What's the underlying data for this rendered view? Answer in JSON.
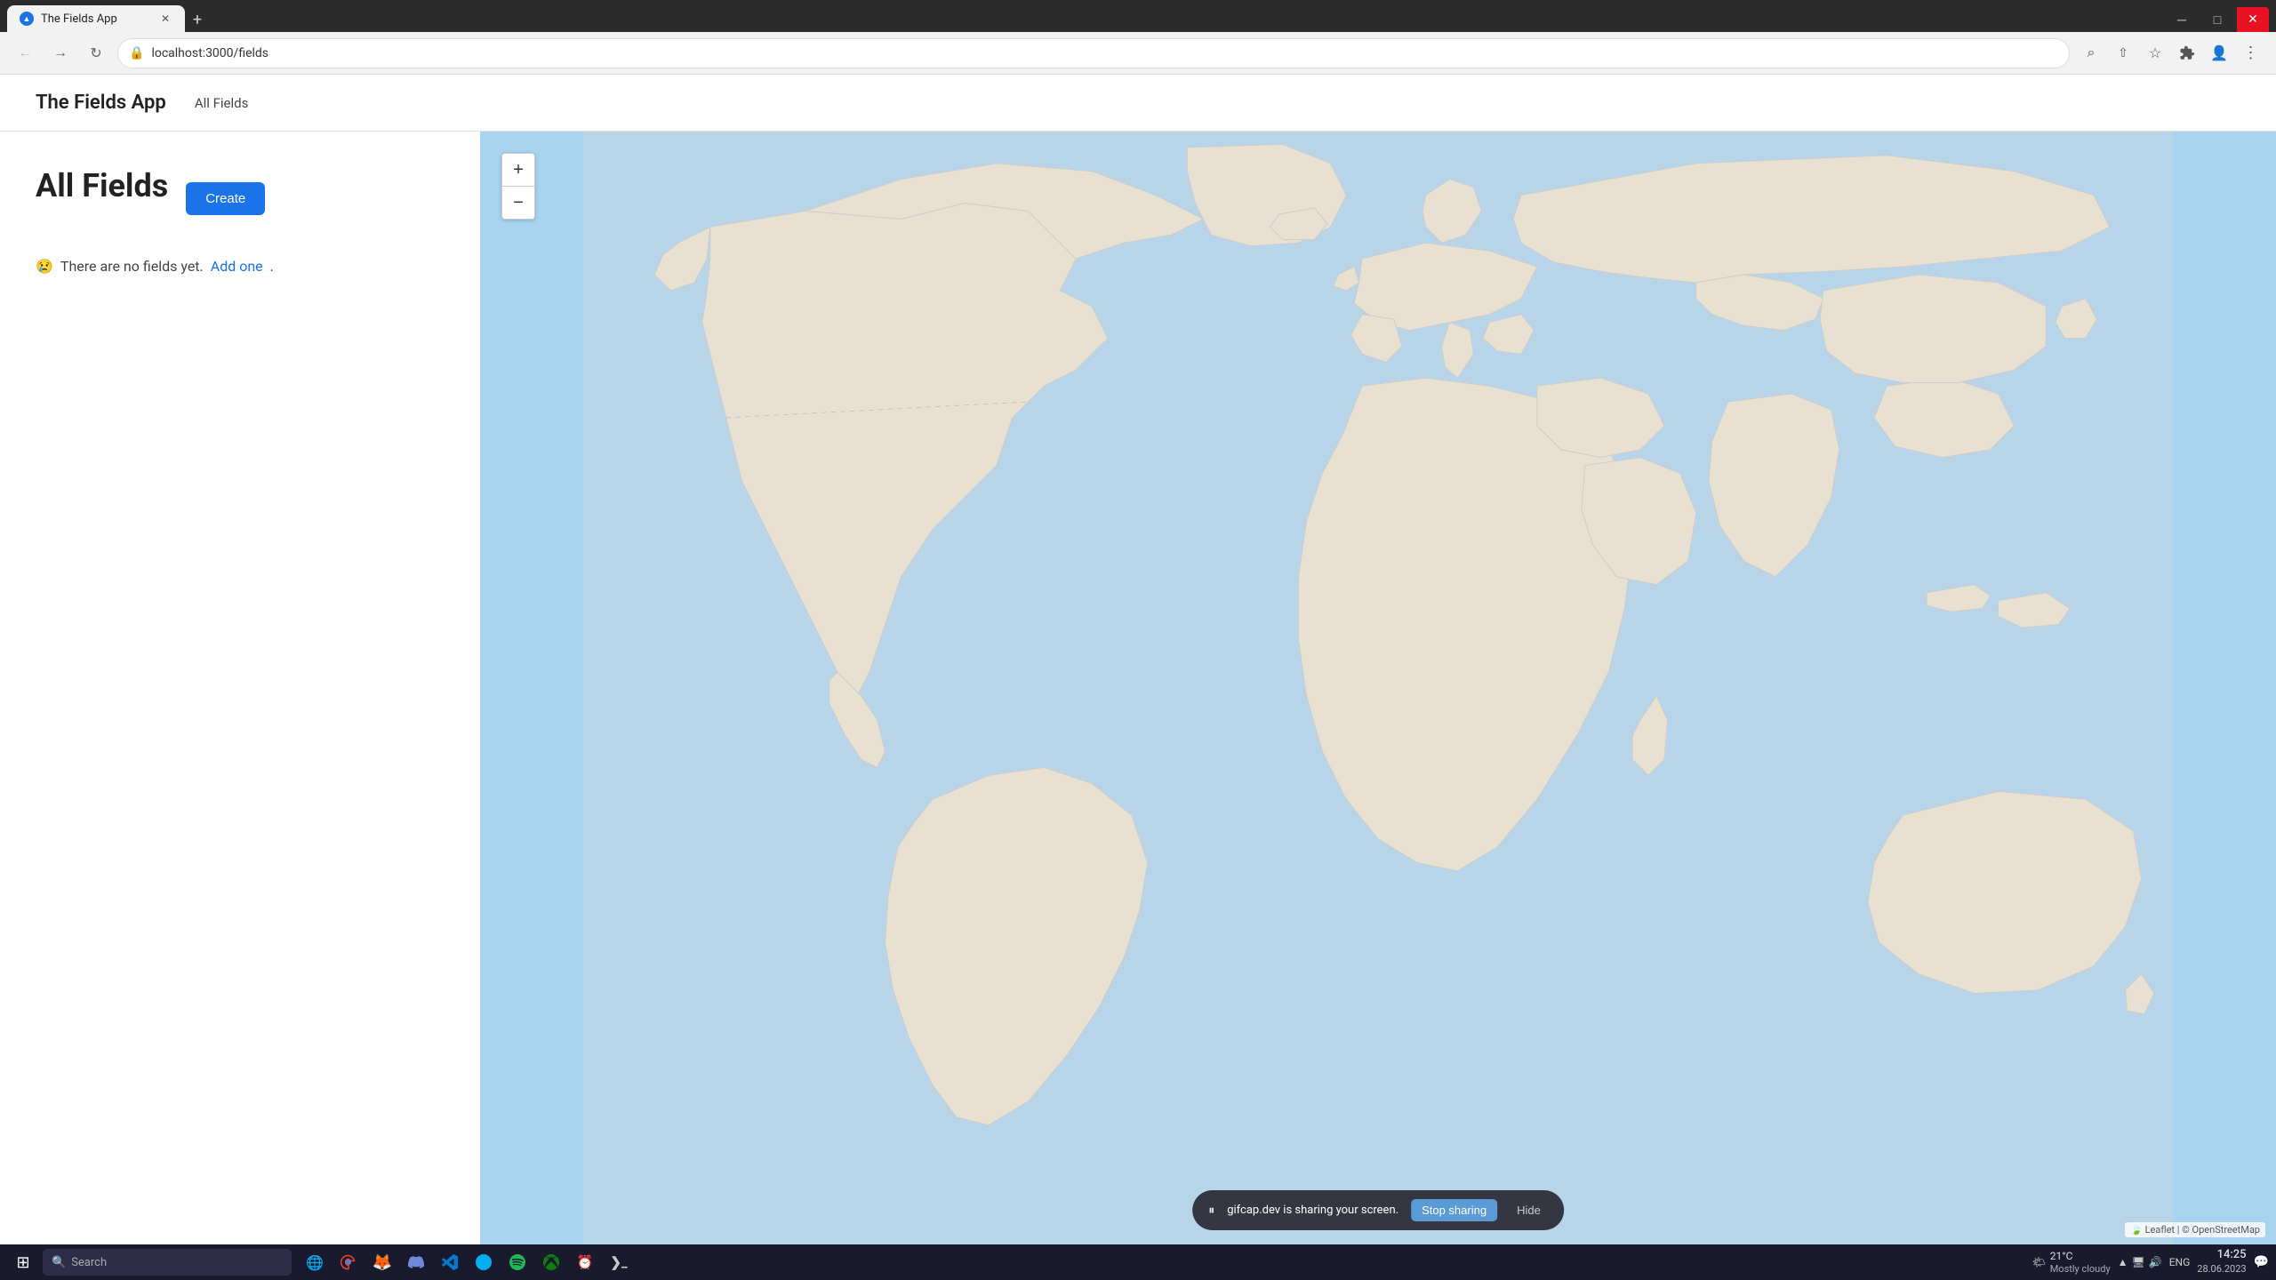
{
  "browser": {
    "tab": {
      "title": "The Fields App",
      "favicon": "▲",
      "url": "localhost:3000/fields"
    },
    "new_tab_label": "+",
    "nav": {
      "back_label": "←",
      "forward_label": "→",
      "refresh_label": "↻",
      "search_label": "⌕",
      "bookmark_label": "☆",
      "extensions_label": "⊞",
      "profile_label": "👤",
      "menu_label": "⋮"
    }
  },
  "app": {
    "title": "The Fields App",
    "nav_link": "All Fields",
    "page_title": "All Fields",
    "create_button": "Create",
    "empty_emoji": "😢",
    "empty_text": "There are no fields yet.",
    "add_one_link": "Add one",
    "empty_period": "."
  },
  "map": {
    "zoom_in_label": "+",
    "zoom_out_label": "−",
    "attribution_leaflet": "🍃 Leaflet",
    "attribution_osm": " | © OpenStreetMap"
  },
  "sharing_bar": {
    "icon": "⏸",
    "text": "gifcap.dev is sharing your screen.",
    "stop_sharing_label": "Stop sharing",
    "hide_label": "Hide"
  },
  "taskbar": {
    "start_icon": "⊞",
    "search_placeholder": "Search",
    "time": "14:25",
    "date": "28.06.2023",
    "language": "ENG",
    "weather_temp": "21°C",
    "weather_desc": "Mostly cloudy",
    "weather_icon": "🌤",
    "apps": [
      {
        "name": "edge-app",
        "icon": "🌐"
      },
      {
        "name": "chrome-app",
        "icon": "🔵"
      },
      {
        "name": "firefox-app",
        "icon": "🦊"
      },
      {
        "name": "discord-app",
        "icon": "💬"
      },
      {
        "name": "vscode-app",
        "icon": "📝"
      },
      {
        "name": "skype-app",
        "icon": "📞"
      },
      {
        "name": "spotify-app",
        "icon": "🎵"
      },
      {
        "name": "xbox-app",
        "icon": "🎮"
      },
      {
        "name": "clock-app",
        "icon": "⏰"
      },
      {
        "name": "terminal-app",
        "icon": "⌨"
      }
    ]
  }
}
